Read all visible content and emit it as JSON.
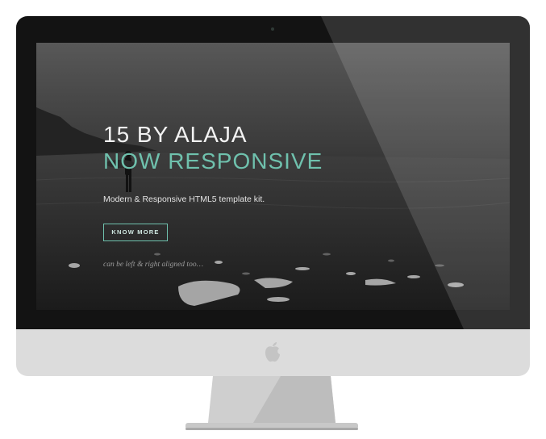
{
  "hero": {
    "title_line1": "15 BY ALAJA",
    "title_line2": "NOW RESPONSIVE",
    "subtitle": "Modern & Responsive HTML5 template kit.",
    "cta_label": "KNOW MORE",
    "tagline": "can be left & right aligned too…"
  },
  "colors": {
    "accent": "#6fc1ad",
    "bezel": "#131313",
    "chin": "#dcdcdc"
  },
  "icons": {
    "logo": "apple-logo-icon",
    "camera": "camera-icon"
  }
}
